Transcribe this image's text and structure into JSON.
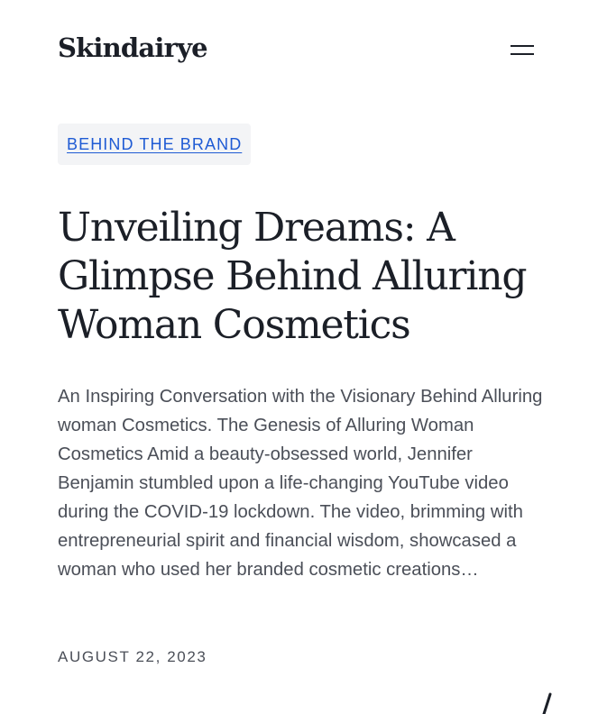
{
  "header": {
    "brand": "Skindairye",
    "menu_icon": "hamburger-menu-icon"
  },
  "post": {
    "category": "BEHIND THE BRAND",
    "title": "Unveiling Dreams: A Glimpse Behind Alluring Woman Cosmetics",
    "excerpt": "An Inspiring Conversation with the Visionary Behind Alluring woman Cosmetics. The Genesis of Alluring Woman Cosmetics  Amid a beauty-obsessed world, Jennifer Benjamin stumbled upon a life-changing YouTube video during the COVID-19 lockdown. The video, brimming with entrepreneurial spirit and financial wisdom, showcased a woman who used her branded cosmetic creations…",
    "date": "AUGUST 22, 2023"
  },
  "colors": {
    "text": "#1b1f27",
    "muted": "#4b4f58",
    "link": "#1f5bd4",
    "tag_background": "#f3f4f6"
  }
}
